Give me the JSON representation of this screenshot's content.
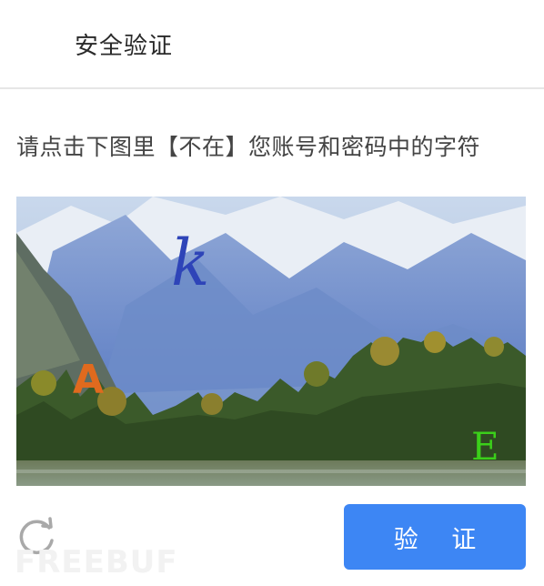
{
  "header": {
    "title": "安全验证"
  },
  "instruction": "请点击下图里【不在】您账号和密码中的字符",
  "captcha": {
    "characters": [
      {
        "text": "k",
        "color": "#2e44b8"
      },
      {
        "text": "A",
        "color": "#e06a1e"
      },
      {
        "text": "E",
        "color": "#3bcf1a"
      }
    ]
  },
  "controls": {
    "refresh_icon": "refresh-icon",
    "verify_label": "验 证",
    "verify_color": "#3d86f4"
  },
  "watermark": "FREEBUF"
}
